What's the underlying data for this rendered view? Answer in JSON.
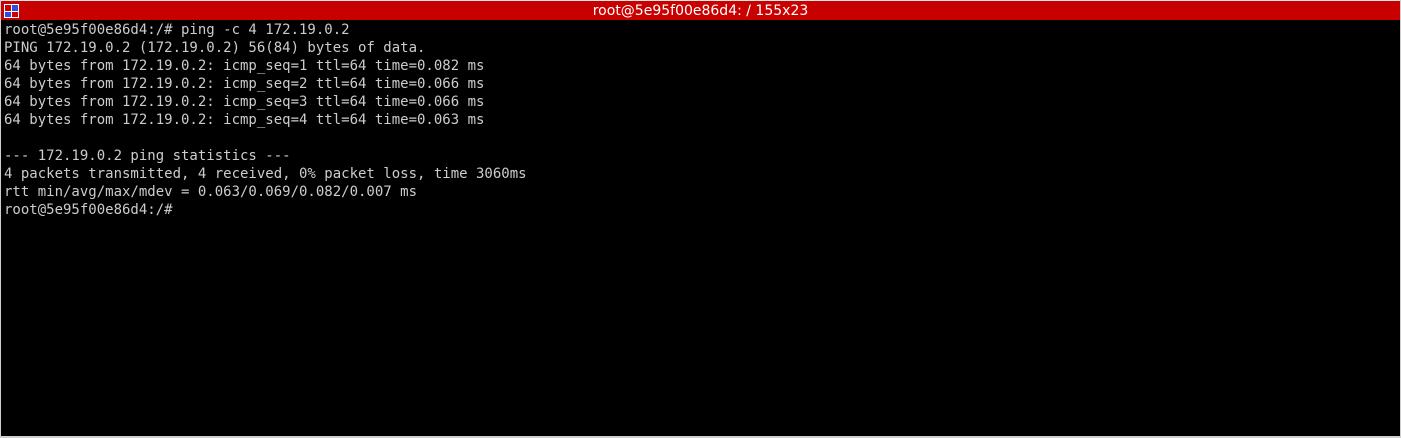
{
  "window": {
    "title": "root@5e95f00e86d4: / 155x23",
    "icon": "terminal-app-icon",
    "colors": {
      "titlebar": "#c90000",
      "background": "#000000",
      "text": "#cccccc"
    }
  },
  "terminal": {
    "lines": [
      "root@5e95f00e86d4:/# ping -c 4 172.19.0.2",
      "PING 172.19.0.2 (172.19.0.2) 56(84) bytes of data.",
      "64 bytes from 172.19.0.2: icmp_seq=1 ttl=64 time=0.082 ms",
      "64 bytes from 172.19.0.2: icmp_seq=2 ttl=64 time=0.066 ms",
      "64 bytes from 172.19.0.2: icmp_seq=3 ttl=64 time=0.066 ms",
      "64 bytes from 172.19.0.2: icmp_seq=4 ttl=64 time=0.063 ms",
      "",
      "--- 172.19.0.2 ping statistics ---",
      "4 packets transmitted, 4 received, 0% packet loss, time 3060ms",
      "rtt min/avg/max/mdev = 0.063/0.069/0.082/0.007 ms",
      "root@5e95f00e86d4:/#"
    ]
  }
}
